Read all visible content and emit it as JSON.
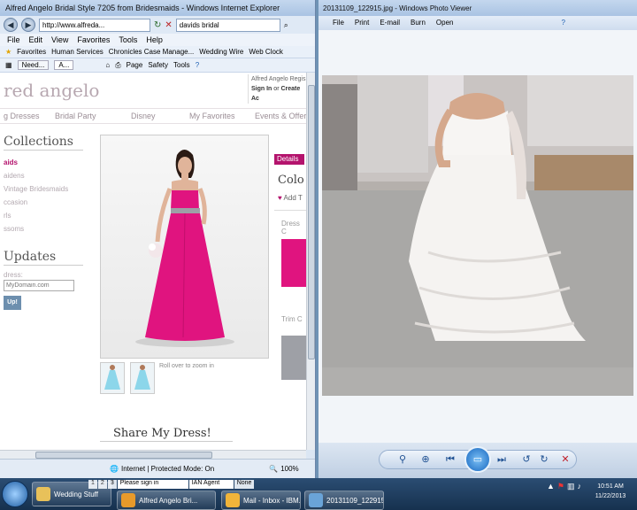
{
  "ie": {
    "title": "Alfred Angelo Bridal Style 7205 from Bridesmaids - Windows Internet Explorer",
    "address": "http://www.alfreda...",
    "search": "davids bridal",
    "menu": [
      "File",
      "Edit",
      "View",
      "Favorites",
      "Tools",
      "Help"
    ],
    "favorites_label": "Favorites",
    "bookmarks": [
      "Human Services",
      "Chronicles Case Manage...",
      "Wedding Wire",
      "Web Clock"
    ],
    "tabs": [
      "Need...",
      "A..."
    ],
    "cmd": [
      "Page",
      "Safety",
      "Tools"
    ],
    "status": "Internet | Protected Mode: On",
    "zoom": "100%"
  },
  "site": {
    "brand": "red angelo",
    "account_line1": "Alfred Angelo Regis",
    "sign_in": "Sign In",
    "or": "or",
    "create": "Create Ac",
    "nav": [
      "g Dresses",
      "Bridal Party",
      "Disney",
      "My Favorites",
      "Events & Offers"
    ],
    "collections_title": "Collections",
    "collections": [
      "aids",
      "aidens",
      "Vintage Bridesmaids",
      "ccasion",
      "rls",
      "ssoms"
    ],
    "updates_title": "Updates",
    "email_label": "dress:",
    "email_placeholder": "MyDomain.com",
    "signup": "Up!",
    "rollover": "Roll over to zoom in",
    "share": "Share My Dress!",
    "details_tab": "Details",
    "colo": "Colo",
    "add_to": "Add T",
    "dress_c": "Dress C",
    "trim_c": "Trim C"
  },
  "pv": {
    "title": "20131109_122915.jpg - Windows Photo Viewer",
    "menu": [
      "File",
      "Print",
      "E-mail",
      "Burn",
      "Open"
    ]
  },
  "taskbar": {
    "items": [
      "Wedding Stuff",
      "Alfred Angelo Bri...",
      "Mail - Inbox - IBM...",
      "20131109_122915.jpg..."
    ],
    "tray_text": [
      "Please sign in",
      "IAN Agent",
      "None"
    ],
    "mini_numbers": [
      "1",
      "2",
      "3"
    ],
    "time": "10:51 AM",
    "date": "11/22/2013"
  },
  "colors": {
    "dress": "#e0147f",
    "accent": "#b4136d",
    "sash": "#9ea0a6"
  }
}
